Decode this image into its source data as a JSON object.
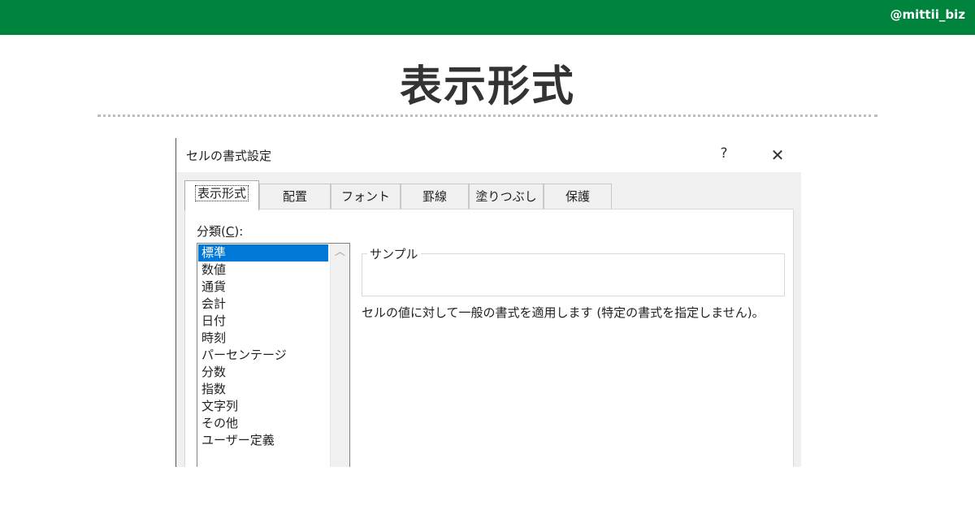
{
  "banner": {
    "handle": "@mittii_biz",
    "color": "#00843d"
  },
  "slide": {
    "title": "表示形式"
  },
  "dialog": {
    "title": "セルの書式設定",
    "help_label": "?",
    "close_label": "✕",
    "tabs": [
      {
        "label": "表示形式",
        "active": true
      },
      {
        "label": "配置"
      },
      {
        "label": "フォント"
      },
      {
        "label": "罫線"
      },
      {
        "label": "塗りつぶし"
      },
      {
        "label": "保護"
      }
    ],
    "category_label_prefix": "分類(",
    "category_label_key": "C",
    "category_label_suffix": "):",
    "categories": [
      "標準",
      "数値",
      "通貨",
      "会計",
      "日付",
      "時刻",
      "パーセンテージ",
      "分数",
      "指数",
      "文字列",
      "その他",
      "ユーザー定義"
    ],
    "selected_category": "標準",
    "sample_label": "サンプル",
    "description": "セルの値に対して一般の書式を適用します (特定の書式を指定しません)。",
    "selection_color": "#0078d7"
  }
}
